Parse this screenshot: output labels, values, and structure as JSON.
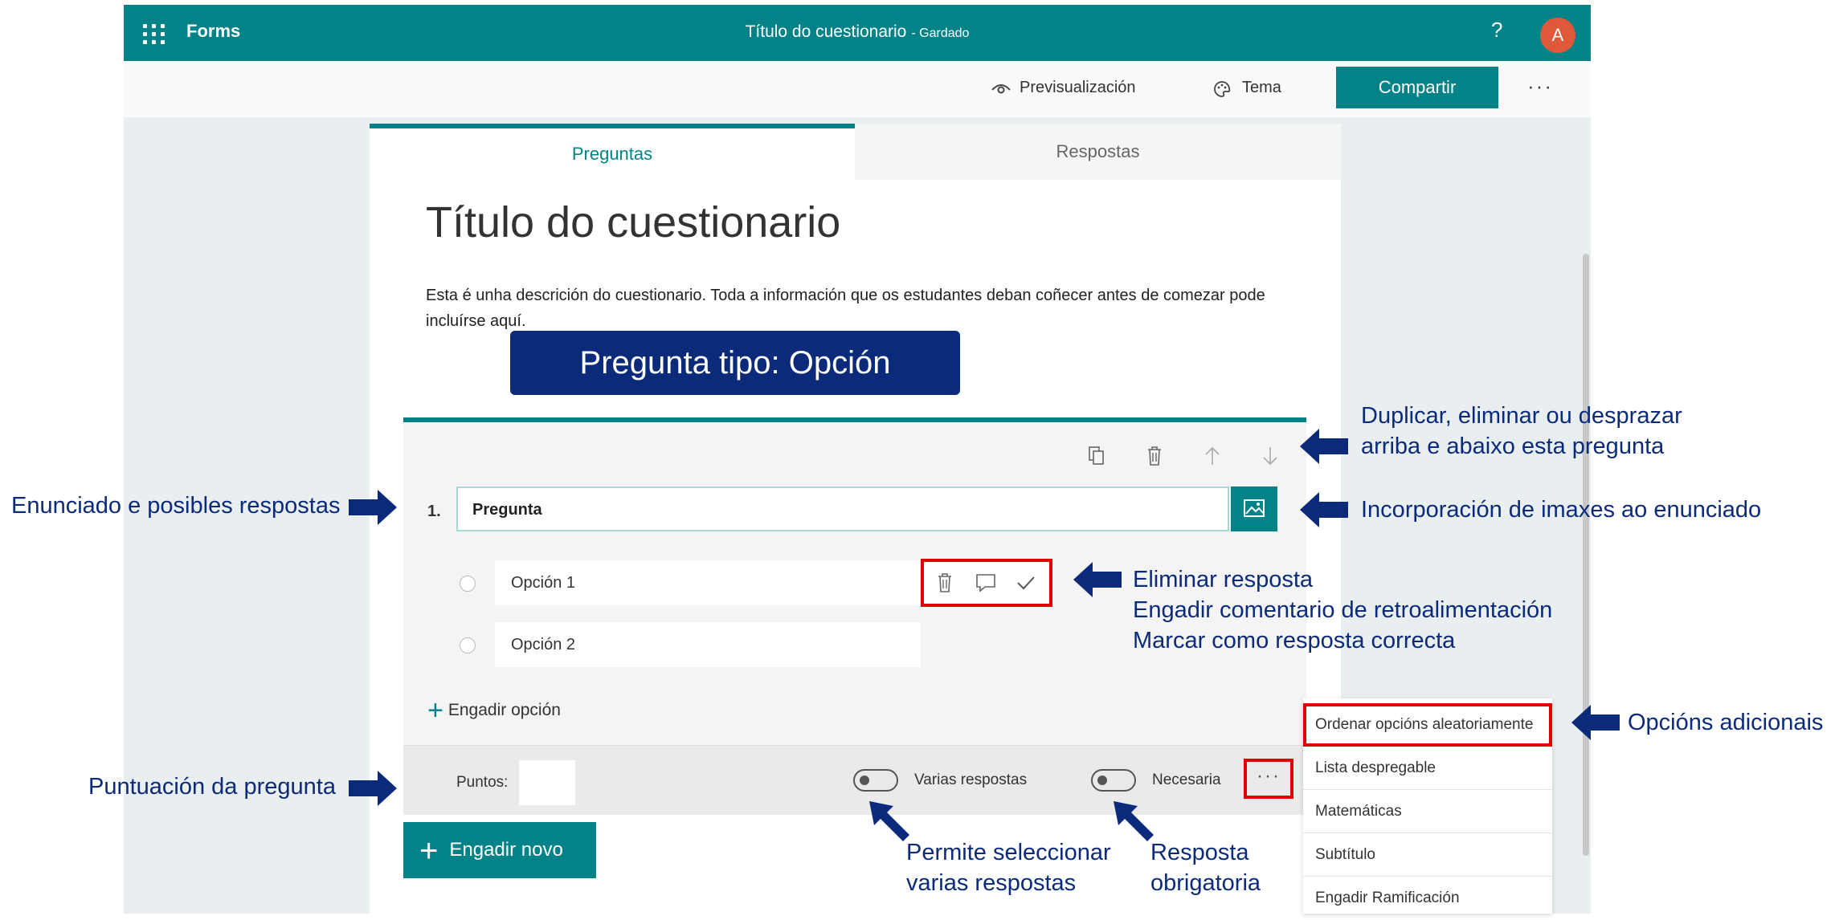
{
  "app": {
    "brand": "Forms",
    "title": "Título do cuestionario",
    "saved_status": "- Gardado",
    "help_symbol": "?",
    "avatar_initial": "A",
    "accent_color": "#038387",
    "annotation_color": "#0b2b7a",
    "highlight_color": "#e00000"
  },
  "commands": {
    "preview": "Previsualización",
    "theme": "Tema",
    "share": "Compartir",
    "more": "···"
  },
  "tabs": {
    "questions": "Preguntas",
    "responses": "Respostas"
  },
  "form": {
    "title": "Título do cuestionario",
    "description": "Esta é unha descrición do cuestionario. Toda a información que os estudantes deban coñecer antes de comezar pode incluírse aquí."
  },
  "question_type_banner": "Pregunta tipo: Opción",
  "question": {
    "number": "1.",
    "text": "Pregunta",
    "options": [
      "Opción 1",
      "Opción 2"
    ],
    "add_option": "Engadir opción",
    "points_label": "Puntos:",
    "multiple_answers": "Varias respostas",
    "required": "Necesaria",
    "more": "···"
  },
  "add_new": "Engadir novo",
  "more_menu": [
    "Ordenar opcións aleatoriamente",
    "Lista despregable",
    "Matemáticas",
    "Subtítulo",
    "Engadir Ramificación"
  ],
  "annotations": {
    "statement": "Enunciado e posibles respostas",
    "score": "Puntuación da pregunta",
    "duplicate_line1": "Duplicar, eliminar ou desprazar",
    "duplicate_line2": "arriba e abaixo esta pregunta",
    "images": "Incorporación de imaxes ao enunciado",
    "answer_line1": "Eliminar resposta",
    "answer_line2": "Engadir comentario de retroalimentación",
    "answer_line3": "Marcar como resposta correcta",
    "additional": "Opcións adicionais",
    "multi_line1": "Permite seleccionar",
    "multi_line2": "varias respostas",
    "required_line1": "Resposta",
    "required_line2": "obrigatoria"
  },
  "icons": [
    "waffle-icon",
    "eye-icon",
    "palette-icon",
    "copy-icon",
    "trash-icon",
    "arrow-up-icon",
    "arrow-down-icon",
    "image-icon",
    "comment-icon",
    "check-icon",
    "plus-icon"
  ]
}
